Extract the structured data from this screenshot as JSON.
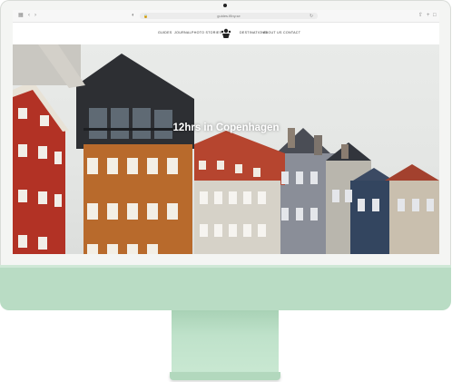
{
  "browser": {
    "url": "guides.f8ny.se",
    "back_icon": "chevron-left-icon",
    "forward_icon": "chevron-right-icon"
  },
  "nav": {
    "items_left": [
      "Guides",
      "Journal",
      "Photo Stories"
    ],
    "items_right": [
      "Destinations",
      "About us",
      "Contact"
    ]
  },
  "hero": {
    "title": "12hrs in Copenhagen"
  },
  "colors": {
    "frame": "#f4f5f3",
    "chin": "#b9dcc4",
    "stand": "#bfe2ca"
  }
}
